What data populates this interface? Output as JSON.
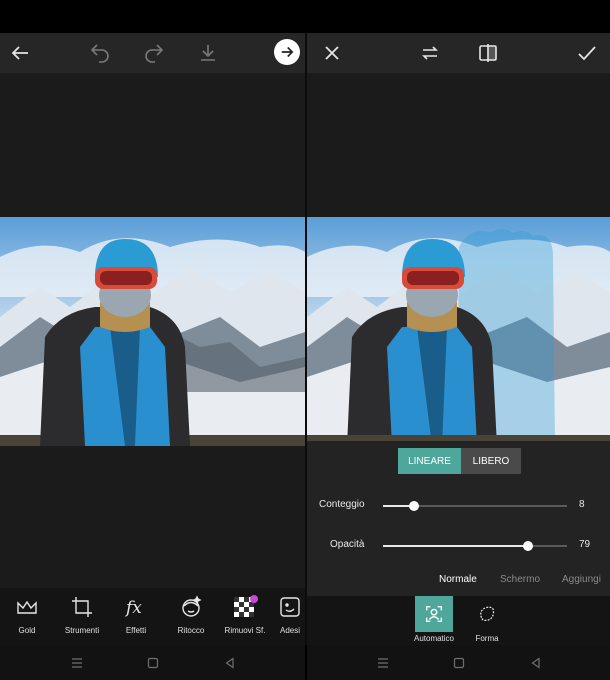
{
  "colors": {
    "accent": "#4fa79c",
    "panel_bg": "#1b1b1b",
    "toolbar_bg": "#262626",
    "settings_bg": "#232323"
  },
  "left_editor": {
    "topbar_icons": [
      "back-arrow-icon",
      "undo-icon",
      "redo-icon",
      "download-icon",
      "next-arrow-icon"
    ],
    "tools": [
      {
        "label": "Gold",
        "icon": "crown-icon"
      },
      {
        "label": "Strumenti",
        "icon": "crop-icon"
      },
      {
        "label": "Effetti",
        "icon": "fx-icon"
      },
      {
        "label": "Ritocco",
        "icon": "face-icon"
      },
      {
        "label": "Rimuovi Sf.",
        "icon": "checker-icon"
      },
      {
        "label": "Adesi",
        "icon": "sticker-icon"
      }
    ]
  },
  "right_editor": {
    "topbar_icons": [
      "close-icon",
      "swap-icon",
      "compare-icon",
      "check-icon"
    ],
    "segments": {
      "lineare": "LINEARE",
      "libero": "LIBERO"
    },
    "sliders": {
      "conteggio": {
        "label": "Conteggio",
        "value": "8",
        "fraction": 0.17
      },
      "opacita": {
        "label": "Opacità",
        "value": "79",
        "fraction": 0.79
      }
    },
    "blend_modes": [
      "Normale",
      "Schermo",
      "Aggiungi"
    ],
    "active_blend_mode": "Normale",
    "mode_tools": [
      {
        "label": "Automatico",
        "icon": "person-icon",
        "active": true
      },
      {
        "label": "Forma",
        "icon": "lasso-icon",
        "active": false
      }
    ]
  },
  "navbar_icons": [
    "menu-icon",
    "home-square-icon",
    "back-triangle-icon"
  ]
}
